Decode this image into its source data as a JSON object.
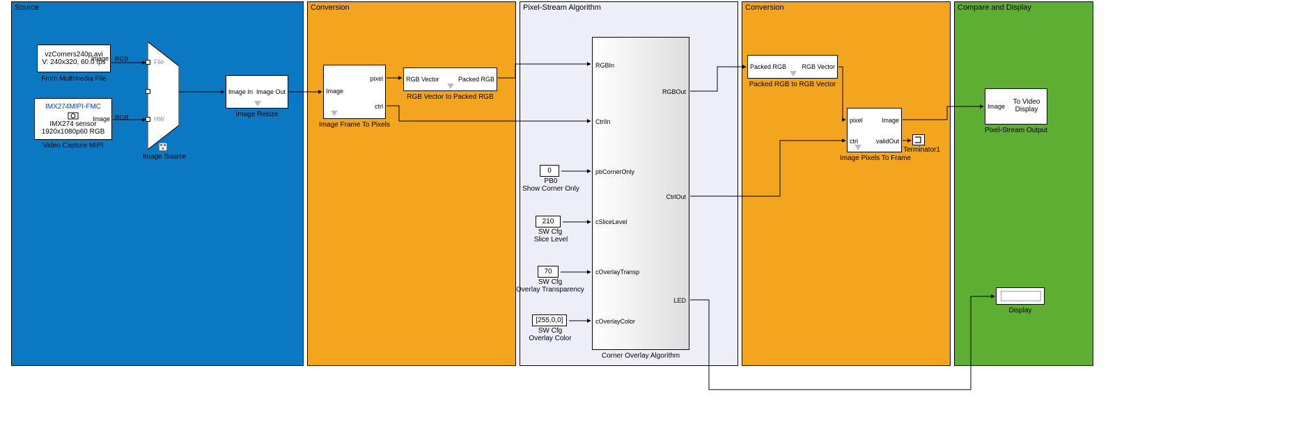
{
  "regions": {
    "source": {
      "title": "Source"
    },
    "conv1": {
      "title": "Conversion"
    },
    "algo": {
      "title": "Pixel-Stream Algorithm"
    },
    "conv2": {
      "title": "Conversion"
    },
    "compare": {
      "title": "Compare and Display"
    }
  },
  "source": {
    "mm_file_line1": "vzCorners240p.avi",
    "mm_file_line2": "V: 240x320, 60.0 fps",
    "mm_file_port": "Image",
    "mm_file_caption": "From Multimedia File",
    "mipi_sensor_link": "IMX274MIPI-FMC",
    "mipi_line2": "IMX274 sensor",
    "mipi_line3": "1920x1080p60 RGB",
    "mipi_port": "Image",
    "mipi_caption": "Video Capture MIPI",
    "switch_file": "File",
    "switch_hw": "HW",
    "switch_caption": "Image Source",
    "resize_in": "Image In",
    "resize_out": "Image Out",
    "resize_caption": "Image Resize",
    "rgb_sig1": "RGB",
    "rgb_sig2": "RGB"
  },
  "conv1": {
    "frame_to_px_img": "Image",
    "frame_to_px_pixel": "pixel",
    "frame_to_px_ctrl": "ctrl",
    "frame_to_px_caption": "Image Frame To Pixels",
    "rgb_vec_in": "RGB Vector",
    "rgb_pack_out": "Packed RGB",
    "rgb_pack_caption": "RGB Vector to Packed RGB"
  },
  "algo": {
    "pb0_value": "0",
    "pb0_cap1": "PB0",
    "pb0_cap2": "Show Corner Only",
    "slice_value": "210",
    "slice_cap1": "SW Cfg",
    "slice_cap2": "Slice Level",
    "transp_value": "70",
    "transp_cap1": "SW Cfg",
    "transp_cap2": "Overlay Transparency",
    "color_value": "[255,0,0]",
    "color_cap1": "SW Cfg",
    "color_cap2": "Overlay Color",
    "in_rgb": "RGBIn",
    "in_ctrl": "CtrlIn",
    "in_pb": "pbCornerOnly",
    "in_slice": "cSliceLevel",
    "in_transp": "cOverlayTransp",
    "in_color": "cOverlayColor",
    "out_rgb": "RGBOut",
    "out_ctrl": "CtrlOut",
    "out_led": "LED",
    "main_caption": "Corner Overlay Algorithm"
  },
  "conv2": {
    "unpack_in": "Packed RGB",
    "unpack_out": "RGB Vector",
    "unpack_caption": "Packed RGB to RGB Vector",
    "px_to_frame_pixel": "pixel",
    "px_to_frame_ctrl": "ctrl",
    "px_to_frame_image": "Image",
    "px_to_frame_valid": "validOut",
    "px_to_frame_caption": "Image Pixels To Frame",
    "terminator_caption": "Terminator1"
  },
  "compare": {
    "to_video_img": "Image",
    "to_video_label": "To Video Display",
    "to_video_caption": "Pixel-Stream Output",
    "display_caption": "Display"
  },
  "colors": {
    "source_bg": "#0b78c4",
    "conv_bg": "#f4a51f",
    "algo_bg": "#eeeef9",
    "compare_bg": "#5fae34"
  }
}
